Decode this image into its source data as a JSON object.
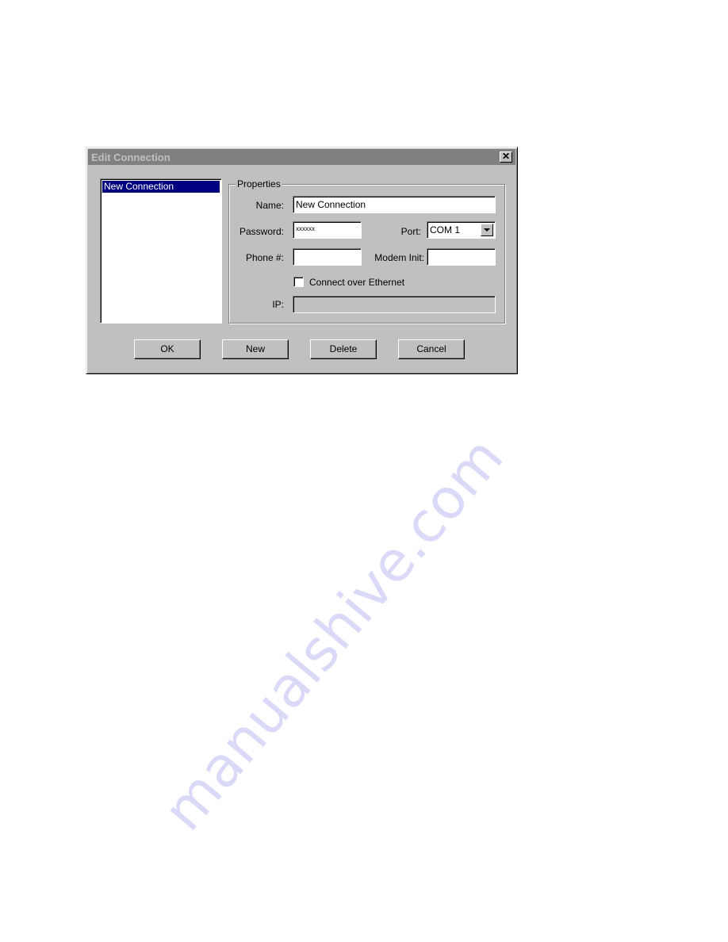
{
  "dialog": {
    "title": "Edit Connection",
    "close_label": "✕"
  },
  "connections_list": {
    "items": [
      "New Connection"
    ],
    "selected": "New Connection"
  },
  "properties": {
    "group_label": "Properties",
    "name_label": "Name:",
    "name_value": "New Connection",
    "password_label": "Password:",
    "password_value": "xxxxxx",
    "port_label": "Port:",
    "port_value": "COM 1",
    "phone_label": "Phone #:",
    "phone_value": "",
    "modem_init_label": "Modem Init:",
    "modem_init_value": "",
    "ethernet_label": "Connect over Ethernet",
    "ethernet_checked": false,
    "ip_label": "IP:",
    "ip_value": ""
  },
  "buttons": {
    "ok": "OK",
    "new": "New",
    "delete": "Delete",
    "cancel": "Cancel"
  },
  "watermark": "manualshive.com",
  "colors": {
    "dialog_bg": "#c0c0c0",
    "titlebar_inactive": "#808080",
    "selection": "#000080"
  }
}
